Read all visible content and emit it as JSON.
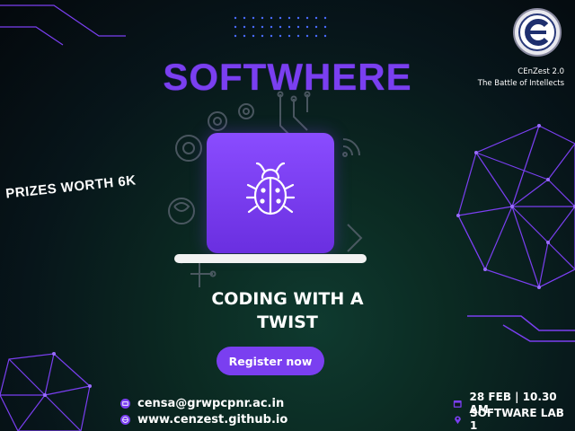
{
  "poster": {
    "title": "SOFTWHERE",
    "org_name": "CEnZest 2.0",
    "org_tagline": "The Battle of Intellects",
    "prizes": "PRIZES WORTH 6K",
    "subtitle_line1": "CODING WITH A",
    "subtitle_line2": "TWIST",
    "register_label": "Register now",
    "email": "censa@grwpcpnr.ac.in",
    "website": "www.cenzest.github.io",
    "date_time": "28 FEB | 10.30 AM",
    "venue": "SOFTWARE LAB 1"
  },
  "icons": [
    "logo-icon",
    "bug-icon",
    "gear-icon",
    "circuit-icon",
    "wifi-icon",
    "brain-icon",
    "email-icon",
    "globe-icon",
    "calendar-icon",
    "location-icon"
  ],
  "colors": {
    "accent": "#7a3ff0",
    "background": "#07151a",
    "text": "#ffffff"
  }
}
